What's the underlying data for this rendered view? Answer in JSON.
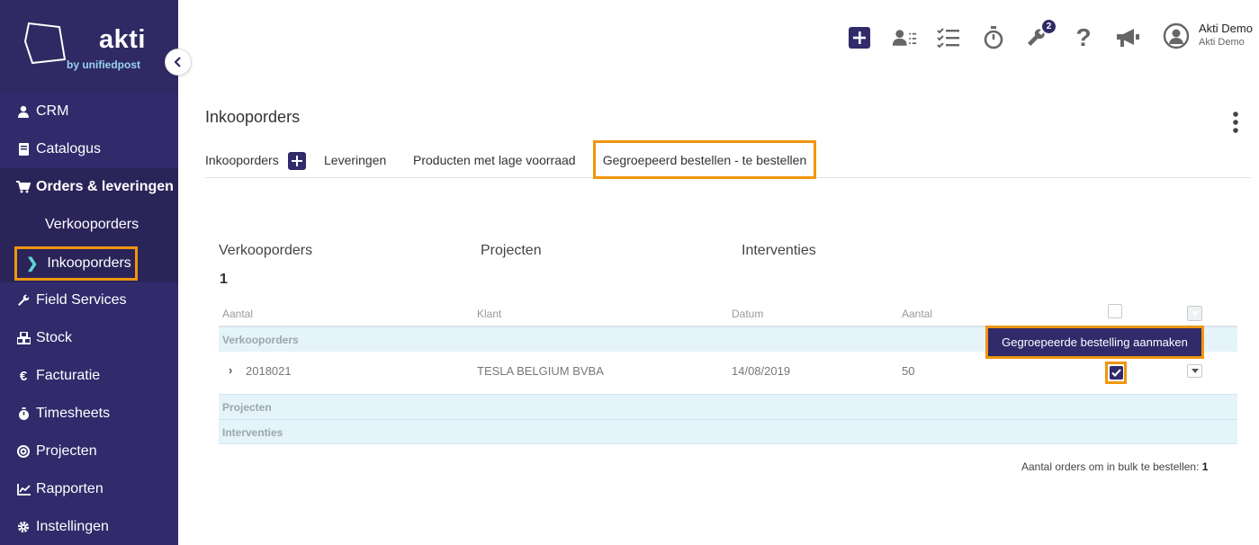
{
  "logo": {
    "name": "akti",
    "tagline": "by unifiedpost"
  },
  "sidebar": {
    "items": [
      {
        "label": "CRM",
        "icon": "user-icon"
      },
      {
        "label": "Catalogus",
        "icon": "book-icon"
      },
      {
        "label": "Orders & leveringen",
        "icon": "cart-icon"
      },
      {
        "label": "Field Services",
        "icon": "wrench-icon"
      },
      {
        "label": "Stock",
        "icon": "cubes-icon"
      },
      {
        "label": "Facturatie",
        "icon": "euro-icon"
      },
      {
        "label": "Timesheets",
        "icon": "stopwatch-icon"
      },
      {
        "label": "Projecten",
        "icon": "target-icon"
      },
      {
        "label": "Rapporten",
        "icon": "chart-icon"
      },
      {
        "label": "Instellingen",
        "icon": "gear-icon"
      }
    ],
    "subitems": [
      {
        "label": "Verkooporders"
      },
      {
        "label": "Inkooporders"
      }
    ]
  },
  "topbar": {
    "badge_count": "2",
    "user_name": "Akti Demo",
    "user_company": "Akti Demo"
  },
  "page": {
    "title": "Inkooporders",
    "tabs": [
      {
        "label": "Inkooporders"
      },
      {
        "label": "Leveringen"
      },
      {
        "label": "Producten met lage voorraad"
      },
      {
        "label": "Gegroepeerd bestellen - te bestellen"
      }
    ]
  },
  "summary": {
    "headers": [
      "Verkooporders",
      "Projecten",
      "Interventies"
    ],
    "value": "1"
  },
  "table": {
    "columns": [
      "Aantal",
      "Klant",
      "Datum",
      "Aantal"
    ],
    "sections": [
      "Verkooporders",
      "Projecten",
      "Interventies"
    ],
    "rows": [
      {
        "number": "2018021",
        "client": "TESLA BELGIUM BVBA",
        "date": "14/08/2019",
        "qty": "50"
      }
    ],
    "action_label": "Gegroepeerde bestelling aanmaken"
  },
  "footer": {
    "label": "Aantal orders om in bulk te bestellen:",
    "count": "1"
  },
  "colors": {
    "sidebar": "#312a6b",
    "highlight": "#f0960e",
    "section_bg": "#e5f4fb"
  }
}
